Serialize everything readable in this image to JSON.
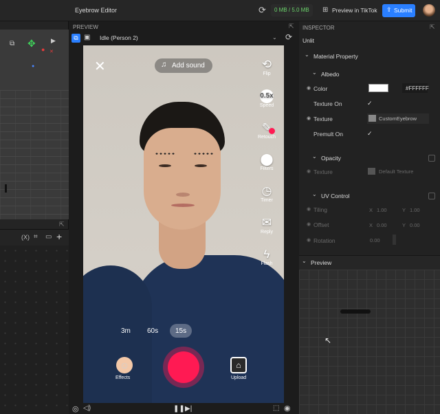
{
  "topbar": {
    "title": "Eyebrow Editor",
    "storage": "0 MB / 5.0 MB",
    "preview_tiktok": "Preview in TikTok",
    "submit": "Submit"
  },
  "left": {
    "fx_label": "(X)"
  },
  "preview": {
    "header": "PREVIEW",
    "state_select": "Idle (Person 2)",
    "add_sound": "Add sound",
    "side": [
      {
        "icon": "flip-icon",
        "glyph": "⟲",
        "label": "Flip"
      },
      {
        "icon": "speed-icon",
        "glyph": "0.5x",
        "label": "Speed"
      },
      {
        "icon": "retouch-icon",
        "glyph": "✎",
        "label": "Retouch"
      },
      {
        "icon": "filters-icon",
        "glyph": "⬤",
        "label": "Filters"
      },
      {
        "icon": "timer-icon",
        "glyph": "◷",
        "label": "Timer"
      },
      {
        "icon": "reply-icon",
        "glyph": "✉",
        "label": "Reply"
      },
      {
        "icon": "flash-icon",
        "glyph": "ϟ",
        "label": "Flash"
      }
    ],
    "durations": [
      "3m",
      "60s",
      "15s"
    ],
    "selected_duration": "15s",
    "effects": "Effects",
    "upload": "Upload"
  },
  "inspector": {
    "header": "INSPECTOR",
    "subtitle": "Unlit",
    "material_property": "Material Property",
    "albedo": "Albedo",
    "color_label": "Color",
    "color_value": "#FFFFFF",
    "texture_on": "Texture On",
    "texture_label": "Texture",
    "texture_value": "CustomEyebrow",
    "premult_on": "Premult On",
    "opacity": "Opacity",
    "opacity_texture": "Texture",
    "opacity_texture_value": "Default Texture",
    "uv_control": "UV Control",
    "tiling": "Tiling",
    "tiling_x_axis": "X",
    "tiling_x": "1.00",
    "tiling_y_axis": "Y",
    "tiling_y": "1.00",
    "offset": "Offset",
    "offset_x_axis": "X",
    "offset_x": "0.00",
    "offset_y_axis": "Y",
    "offset_y": "0.00",
    "rotation": "Rotation",
    "rotation_value": "0.00",
    "preview_section": "Preview"
  },
  "colors": {
    "accent": "#2a7fff",
    "record": "#ff1a53",
    "storage": "#6ad36a"
  }
}
